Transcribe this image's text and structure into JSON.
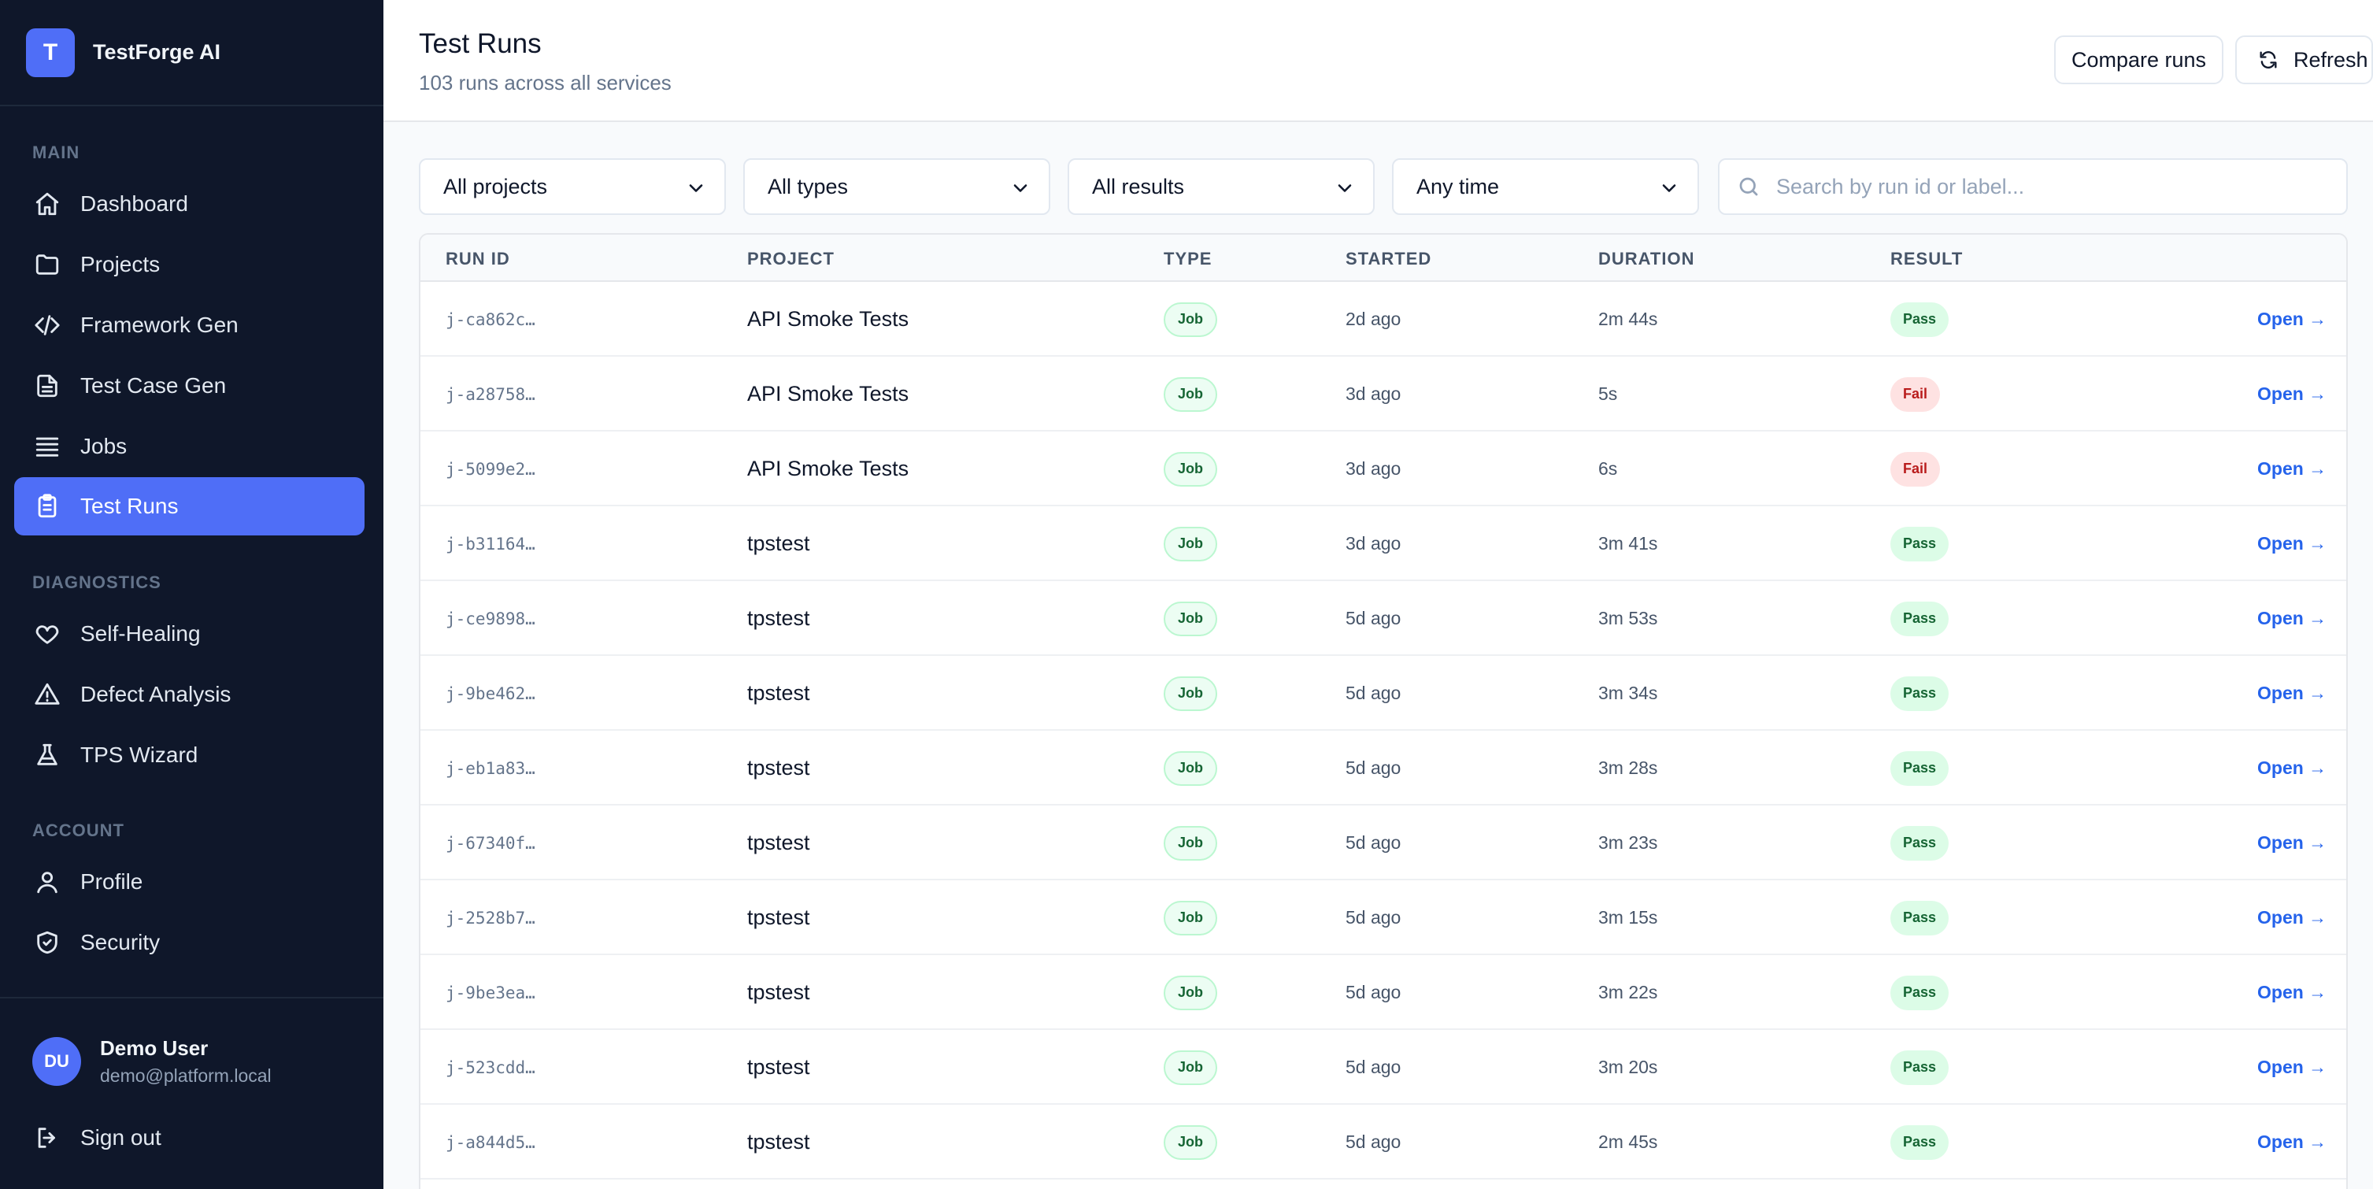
{
  "app": {
    "logo_letter": "T",
    "name": "TestForge AI"
  },
  "sidebar": {
    "sections": {
      "main": "MAIN",
      "diagnostics": "DIAGNOSTICS",
      "account": "ACCOUNT"
    },
    "items": [
      {
        "label": "Dashboard",
        "icon": "home-icon"
      },
      {
        "label": "Projects",
        "icon": "folder-icon"
      },
      {
        "label": "Framework Gen",
        "icon": "code-icon"
      },
      {
        "label": "Test Case Gen",
        "icon": "document-icon"
      },
      {
        "label": "Jobs",
        "icon": "list-icon"
      },
      {
        "label": "Test Runs",
        "icon": "clipboard-icon",
        "active": true
      },
      {
        "label": "Self-Healing",
        "icon": "heart-icon"
      },
      {
        "label": "Defect Analysis",
        "icon": "warning-icon"
      },
      {
        "label": "TPS Wizard",
        "icon": "flask-icon"
      },
      {
        "label": "Profile",
        "icon": "user-icon"
      },
      {
        "label": "Security",
        "icon": "shield-icon"
      },
      {
        "label": "Sign out",
        "icon": "sign-out-icon"
      }
    ],
    "user": {
      "initials": "DU",
      "name": "Demo User",
      "email": "demo@platform.local"
    }
  },
  "header": {
    "title": "Test Runs",
    "subtitle": "103 runs across all services",
    "compare_label": "Compare runs",
    "refresh_label": "Refresh"
  },
  "filters": {
    "project": "All projects",
    "type": "All types",
    "result": "All results",
    "time": "Any time",
    "search_placeholder": "Search by run id or label..."
  },
  "table": {
    "columns": [
      "RUN ID",
      "PROJECT",
      "TYPE",
      "STARTED",
      "DURATION",
      "RESULT"
    ],
    "open_label": "Open →",
    "rows": [
      {
        "id": "j-ca862c…",
        "project": "API Smoke Tests",
        "type": "Job",
        "started": "2d ago",
        "duration": "2m 44s",
        "result": "Pass"
      },
      {
        "id": "j-a28758…",
        "project": "API Smoke Tests",
        "type": "Job",
        "started": "3d ago",
        "duration": "5s",
        "result": "Fail"
      },
      {
        "id": "j-5099e2…",
        "project": "API Smoke Tests",
        "type": "Job",
        "started": "3d ago",
        "duration": "6s",
        "result": "Fail"
      },
      {
        "id": "j-b31164…",
        "project": "tpstest",
        "type": "Job",
        "started": "3d ago",
        "duration": "3m 41s",
        "result": "Pass"
      },
      {
        "id": "j-ce9898…",
        "project": "tpstest",
        "type": "Job",
        "started": "5d ago",
        "duration": "3m 53s",
        "result": "Pass"
      },
      {
        "id": "j-9be462…",
        "project": "tpstest",
        "type": "Job",
        "started": "5d ago",
        "duration": "3m 34s",
        "result": "Pass"
      },
      {
        "id": "j-eb1a83…",
        "project": "tpstest",
        "type": "Job",
        "started": "5d ago",
        "duration": "3m 28s",
        "result": "Pass"
      },
      {
        "id": "j-67340f…",
        "project": "tpstest",
        "type": "Job",
        "started": "5d ago",
        "duration": "3m 23s",
        "result": "Pass"
      },
      {
        "id": "j-2528b7…",
        "project": "tpstest",
        "type": "Job",
        "started": "5d ago",
        "duration": "3m 15s",
        "result": "Pass"
      },
      {
        "id": "j-9be3ea…",
        "project": "tpstest",
        "type": "Job",
        "started": "5d ago",
        "duration": "3m 22s",
        "result": "Pass"
      },
      {
        "id": "j-523cdd…",
        "project": "tpstest",
        "type": "Job",
        "started": "5d ago",
        "duration": "3m 20s",
        "result": "Pass"
      },
      {
        "id": "j-a844d5…",
        "project": "tpstest",
        "type": "Job",
        "started": "5d ago",
        "duration": "2m 45s",
        "result": "Pass"
      }
    ]
  },
  "colors": {
    "sidebar_bg": "#0f172a",
    "accent": "#4f6ef7",
    "pass": "#166534",
    "fail": "#b91c1c",
    "link": "#2563eb"
  }
}
